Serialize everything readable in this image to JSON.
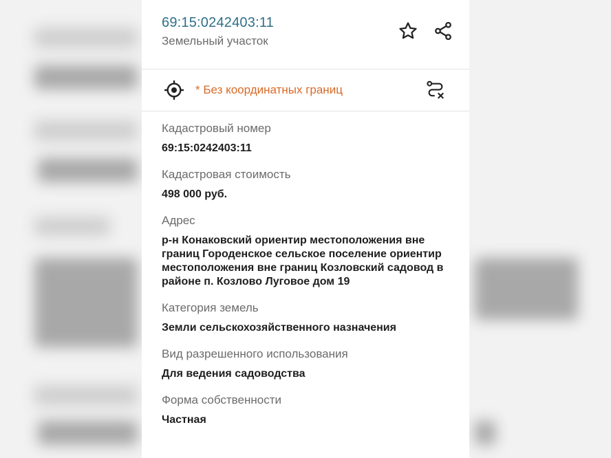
{
  "header": {
    "cadastral_title": "69:15:0242403:11",
    "subtitle": "Земельный участок",
    "favorite_icon": "star-icon",
    "share_icon": "share-icon"
  },
  "toolbar": {
    "locate_icon": "crosshair-icon",
    "notice": "* Без координатных границ",
    "route_icon": "route-off-icon",
    "notice_color": "#d86a26"
  },
  "fields": [
    {
      "label": "Кадастровый номер",
      "value": "69:15:0242403:11"
    },
    {
      "label": "Кадастровая стоимость",
      "value": "498 000 руб."
    },
    {
      "label": "Адрес",
      "value": "р-н Конаковский ориентир местоположения вне границ Городенское сельское поселение ориентир местоположения вне границ Козловский садовод в районе п. Козлово Луговое дом 19"
    },
    {
      "label": "Категория земель",
      "value": "Земли сельскохозяйственного назначения"
    },
    {
      "label": "Вид разрешенного использования",
      "value": "Для ведения садоводства"
    },
    {
      "label": "Форма собственности",
      "value": "Частная"
    }
  ],
  "colors": {
    "title": "#2f6f88",
    "label": "#6b6b6b",
    "value": "#1e1e1e"
  }
}
